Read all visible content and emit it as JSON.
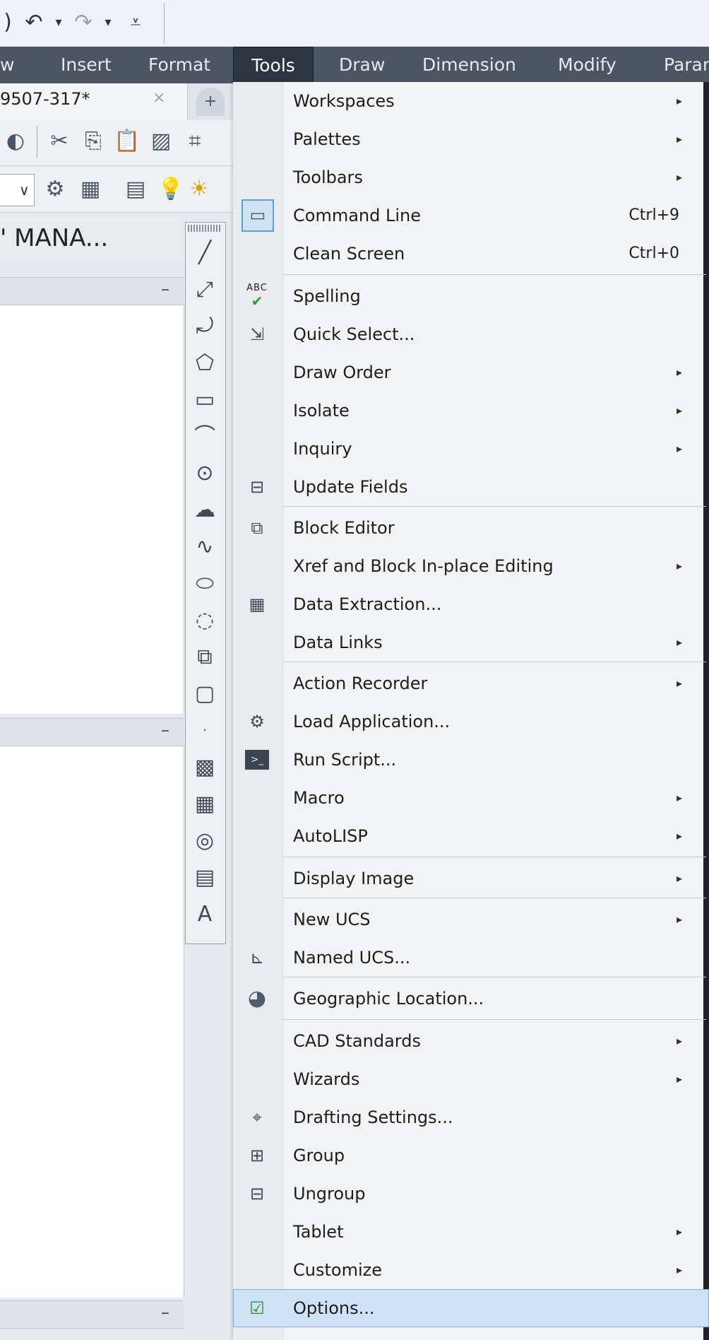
{
  "qat": {
    "icons": [
      "undo-icon",
      "redo-icon",
      "customize-qat-icon"
    ],
    "dropdown_glyph": "▾"
  },
  "menubar": {
    "items": [
      {
        "label": "w"
      },
      {
        "label": "Insert"
      },
      {
        "label": "Format"
      },
      {
        "label": "Tools",
        "active": true
      },
      {
        "label": "Draw"
      },
      {
        "label": "Dimension"
      },
      {
        "label": "Modify"
      },
      {
        "label": "Paran"
      }
    ]
  },
  "document_tab": {
    "label": "9507-317*",
    "close_glyph": "×",
    "new_tab_glyph": "+"
  },
  "palette": {
    "title": "' MANA...",
    "minimize_glyph": "–"
  },
  "tools_menu": {
    "items": [
      {
        "label": "Workspaces",
        "submenu": true
      },
      {
        "label": "Palettes",
        "submenu": true
      },
      {
        "label": "Toolbars",
        "submenu": true
      },
      {
        "label": "Command Line",
        "shortcut": "Ctrl+9",
        "icon": "command-line-icon",
        "checked": true
      },
      {
        "label": "Clean Screen",
        "shortcut": "Ctrl+0"
      },
      {
        "label": "Spelling",
        "icon": "spelling-icon",
        "icon_text": "ABC"
      },
      {
        "label": "Quick Select...",
        "icon": "quick-select-icon"
      },
      {
        "label": "Draw Order",
        "submenu": true
      },
      {
        "label": "Isolate",
        "submenu": true
      },
      {
        "label": "Inquiry",
        "submenu": true
      },
      {
        "label": "Update Fields",
        "icon": "update-fields-icon"
      },
      {
        "label": "Block Editor",
        "icon": "block-editor-icon"
      },
      {
        "label": "Xref and Block In-place Editing",
        "submenu": true
      },
      {
        "label": "Data Extraction...",
        "icon": "data-extraction-icon"
      },
      {
        "label": "Data Links",
        "submenu": true
      },
      {
        "label": "Action Recorder",
        "submenu": true
      },
      {
        "label": "Load Application...",
        "icon": "load-application-icon"
      },
      {
        "label": "Run Script...",
        "icon": "run-script-icon"
      },
      {
        "label": "Macro",
        "submenu": true
      },
      {
        "label": "AutoLISP",
        "submenu": true
      },
      {
        "label": "Display Image",
        "submenu": true
      },
      {
        "label": "New UCS",
        "submenu": true
      },
      {
        "label": "Named UCS...",
        "icon": "named-ucs-icon"
      },
      {
        "label": "Geographic Location...",
        "icon": "globe-icon"
      },
      {
        "label": "CAD Standards",
        "submenu": true
      },
      {
        "label": "Wizards",
        "submenu": true
      },
      {
        "label": "Drafting Settings...",
        "icon": "drafting-settings-icon"
      },
      {
        "label": "Group",
        "icon": "group-icon"
      },
      {
        "label": "Ungroup",
        "icon": "ungroup-icon"
      },
      {
        "label": "Tablet",
        "submenu": true
      },
      {
        "label": "Customize",
        "submenu": true
      },
      {
        "label": "Options...",
        "icon": "options-check-icon",
        "selected": true
      }
    ],
    "submenu_glyph": "▸"
  },
  "colors": {
    "menubar_bg": "#4d5562",
    "selection": "#cfe2f5",
    "selection_border": "#84acd4"
  }
}
